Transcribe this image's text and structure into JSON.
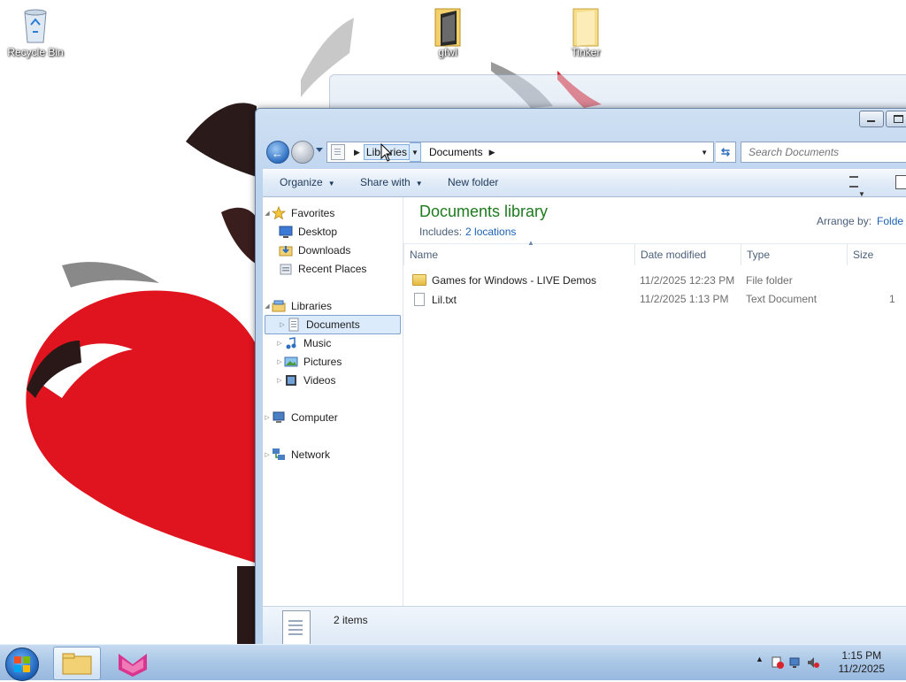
{
  "desktop": {
    "icons": [
      {
        "label": "Recycle Bin",
        "icon": "recycle-bin-icon"
      },
      {
        "label": "gfwl",
        "icon": "folder-icon"
      },
      {
        "label": "Tinker",
        "icon": "folder-icon"
      }
    ]
  },
  "explorer": {
    "breadcrumbs": [
      "Libraries",
      "Documents"
    ],
    "search_placeholder": "Search Documents",
    "toolbar": {
      "organize": "Organize",
      "share_with": "Share with",
      "new_folder": "New folder"
    },
    "nav": {
      "favorites": {
        "label": "Favorites",
        "items": [
          "Desktop",
          "Downloads",
          "Recent Places"
        ]
      },
      "libraries": {
        "label": "Libraries",
        "items": [
          "Documents",
          "Music",
          "Pictures",
          "Videos"
        ]
      },
      "computer": "Computer",
      "network": "Network"
    },
    "library": {
      "title": "Documents library",
      "includes_label": "Includes:",
      "includes_link": "2 locations",
      "arrange_label": "Arrange by:",
      "arrange_value": "Folde"
    },
    "columns": [
      "Name",
      "Date modified",
      "Type",
      "Size"
    ],
    "files": [
      {
        "name": "Games for Windows - LIVE Demos",
        "date": "11/2/2025 12:23 PM",
        "type": "File folder",
        "size": "",
        "icon": "folder-icon"
      },
      {
        "name": "Lil.txt",
        "date": "11/2/2025 1:13 PM",
        "type": "Text Document",
        "size": "1",
        "icon": "text-file-icon"
      }
    ],
    "details": {
      "count": "2 items"
    }
  },
  "taskbar": {
    "time": "1:15 PM",
    "date": "11/2/2025"
  },
  "colors": {
    "library_title": "#1e7a1e",
    "link": "#1b61b6",
    "selection": "#dcebfc",
    "wallpaper_red": "#e0141e"
  }
}
